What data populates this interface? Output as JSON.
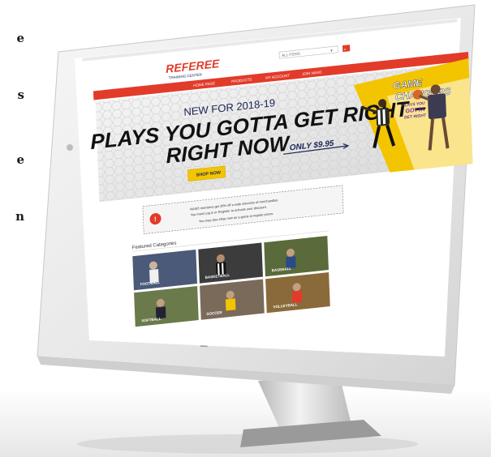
{
  "page_edge_text": [
    "e",
    "s",
    "e",
    "n"
  ],
  "site": {
    "logo_main": "REFEREE",
    "logo_sub": "TRAINING CENTER",
    "search_placeholder": "ALL ITEMS",
    "nav": [
      "HOME PAGE",
      "PRODUCTS",
      "MY ACCOUNT",
      "JOIN NASO"
    ],
    "hero": {
      "kicker": "NEW FOR 2018-19",
      "headline_1": "PLAYS YOU GOTTA GET RIGHT –",
      "headline_2": "RIGHT NOW",
      "price": "ONLY $9.95",
      "button": "SHOP NOW",
      "promo_title_1": "GAME",
      "promo_title_2": "CHANGERS",
      "promo_sub_1": "PLAYS YOU",
      "promo_sub_2": "GOTTA",
      "promo_sub_3": "GET RIGHT"
    },
    "notice": {
      "line1": "NASO members get 30% off a wide selection of merchandise.",
      "line2": "You must Log in or Register to activate your discount.",
      "line3": "You may also shop now as a guest at regular prices."
    },
    "featured_title": "Featured Categories",
    "categories": [
      "FOOTBALL",
      "BASKETBALL",
      "BASEBALL",
      "SOFTBALL",
      "SOCCER",
      "VOLLEYBALL"
    ]
  },
  "colors": {
    "accent_red": "#e23b2a",
    "button_yellow": "#f3c400",
    "navy": "#1b2554"
  }
}
